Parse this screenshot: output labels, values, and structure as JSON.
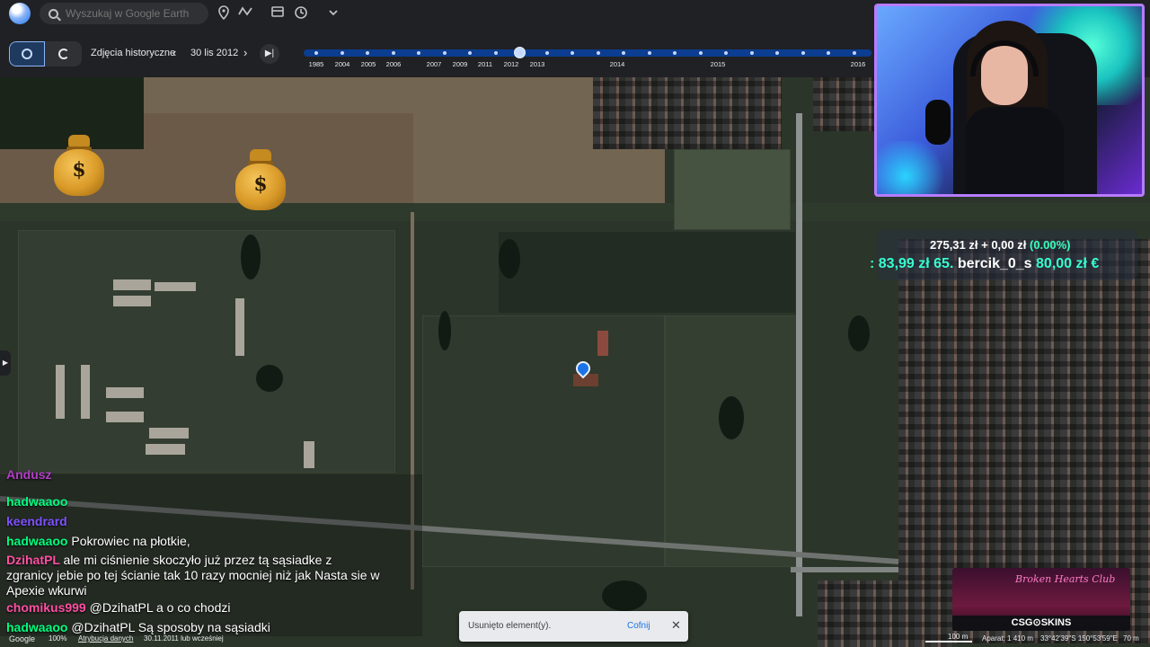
{
  "search": {
    "placeholder": "Wyszukaj w Google Earth"
  },
  "history": {
    "label": "Zdjęcia historyczne",
    "date": "30 lis 2012",
    "timeline_position": 0.38,
    "years": [
      "1985",
      "2004",
      "2005",
      "2006",
      "2007",
      "2009",
      "2011",
      "2012",
      "2013",
      "2014",
      "2015",
      "2016"
    ]
  },
  "map_overlay": {
    "money_sign": "$"
  },
  "donation": {
    "amount": "275,31 zł",
    "plus_label": "+ 0,00 zł",
    "percent": "(0.00%)",
    "ticker": [
      {
        "text": ": 83,99 zł",
        "kind": "amount"
      },
      {
        "text": "65.",
        "kind": "amount"
      },
      {
        "text": "bercik_0_s",
        "kind": "name"
      },
      {
        "text": "80,00 zł",
        "kind": "amount"
      },
      {
        "text": "€",
        "kind": "amount"
      }
    ]
  },
  "chat": {
    "messages": [
      {
        "user": "Andusz",
        "text": "",
        "user_color": "#b33dc6"
      },
      {
        "user": "hadwaaoo",
        "text": "",
        "user_color": "#00ff7f"
      },
      {
        "user": "keendrard",
        "text": "",
        "user_color": "#7f52ff"
      },
      {
        "user": "hadwaaoo",
        "text": "Pokrowiec na płotkie,",
        "user_color": "#00ff7f"
      },
      {
        "user": "DzihatPL",
        "text": "ale mi ciśnienie skoczyło już przez tą sąsiadke z",
        "user_color": "#ff4fa3"
      },
      {
        "user": "",
        "text": "zgranicy jebie po tej ścianie tak 10 razy mocniej niż jak Nasta sie w",
        "user_color": "#ffffff"
      },
      {
        "user": "",
        "text": "Apexie wkurwi",
        "user_color": "#ffffff"
      },
      {
        "user": "chomikus999",
        "text": "@DzihatPL a o co chodzi",
        "user_color": "#ff4fa3"
      },
      {
        "user": "hadwaaoo",
        "text": "@DzihatPL Są sposoby na sąsiadki",
        "user_color": "#00ff7f"
      }
    ]
  },
  "toast": {
    "message": "Usunięto element(y).",
    "undo_label": "Cofnij",
    "close_icon": "✕"
  },
  "status": {
    "google": "Google",
    "zoom": "100%",
    "attribution": "Atrybucja danych",
    "date_info": "30.11.2011 lub wcześniej",
    "scale": "100 m",
    "camera": "Aparat: 1 410 m",
    "coords": "33°42'39\"S 150°53'59\"E",
    "altitude": "70 m"
  },
  "sponsor": {
    "sign": "Broken Hearts Club",
    "brand": "CSG⊙SKINS"
  },
  "colors": {
    "timeline": "#0b3d91",
    "ticker": "#35ffd2",
    "accent": "#8ab4f8"
  }
}
